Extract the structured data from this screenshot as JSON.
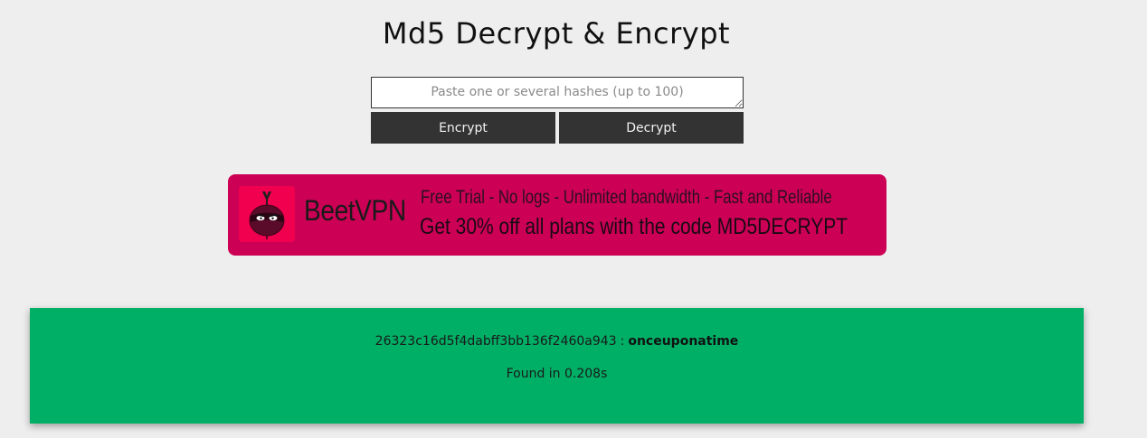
{
  "header": {
    "title": "Md5 Decrypt & Encrypt"
  },
  "form": {
    "input_placeholder": "Paste one or several hashes (up to 100)",
    "input_value": "",
    "encrypt_label": "Encrypt",
    "decrypt_label": "Decrypt"
  },
  "ad": {
    "brand": "BeetVPN",
    "line1": "Free Trial - No logs - Unlimited bandwidth - Fast and Reliable",
    "line2": "Get 30% off all plans with the code MD5DECRYPT",
    "background_color": "#cc0055",
    "logo_icon": "beet-ninja-icon"
  },
  "result": {
    "hash": "26323c16d5f4dabff3bb136f2460a943",
    "separator": ":",
    "value": "onceuponatime",
    "time_text": "Found in 0.208s",
    "background_color": "#00af66"
  },
  "colors": {
    "page_background": "#eeeeee",
    "button_background": "#333333",
    "button_text": "#f2f2f2"
  }
}
